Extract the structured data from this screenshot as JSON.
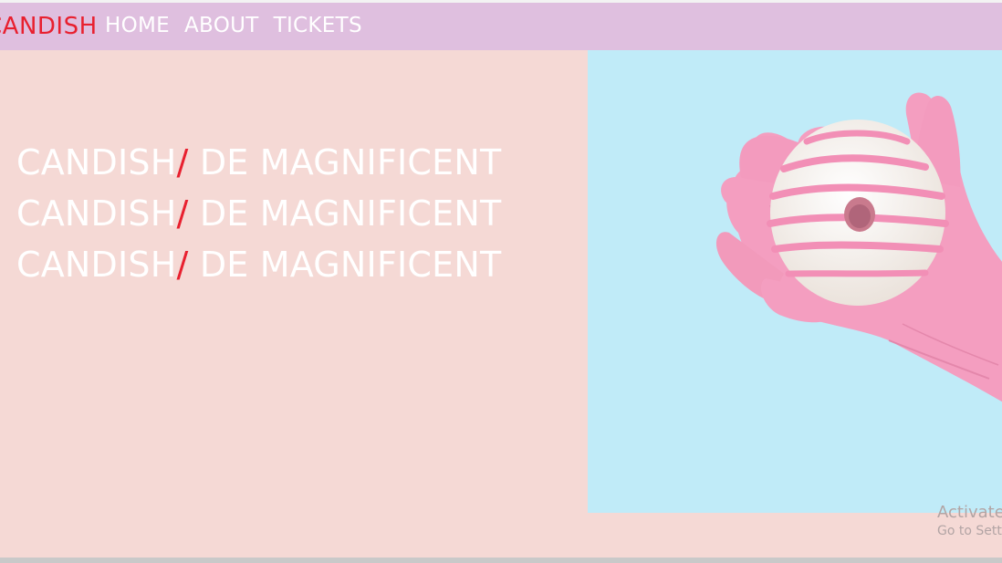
{
  "nav": {
    "brand": "CANDISH",
    "links": [
      "HOME",
      "ABOUT",
      "TICKETS"
    ]
  },
  "hero": {
    "headlines": [
      {
        "word": "CANDISH",
        "slash": "/",
        "rest": " DE MAGNIFICENT"
      },
      {
        "word": "CANDISH",
        "slash": "/",
        "rest": " DE MAGNIFICENT"
      },
      {
        "word": "CANDISH",
        "slash": "/",
        "rest": " DE MAGNIFICENT"
      }
    ],
    "image_icon": "pink-gloved-hand-holding-donut"
  },
  "watermark": {
    "line1": "Activate Windows",
    "line2": "Go to Settings to activate Windows."
  },
  "colors": {
    "nav_bg": "#dfbfdf",
    "page_bg": "#f5d9d5",
    "accent": "#e8202f",
    "image_bg": "#c0ebf8",
    "glove": "#f49ec0",
    "donut": "#f6f1ec"
  }
}
